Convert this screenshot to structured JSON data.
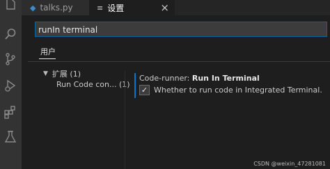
{
  "activity_bar": {
    "items": [
      {
        "icon": "files-icon"
      },
      {
        "icon": "search-icon"
      },
      {
        "icon": "source-control-icon"
      },
      {
        "icon": "run-debug-icon"
      },
      {
        "icon": "extensions-icon"
      },
      {
        "icon": "testing-icon"
      }
    ]
  },
  "tabs": {
    "file_tab": {
      "label": "talks.py",
      "icon": "python-file-icon"
    },
    "settings_tab": {
      "label": "设置",
      "icon": "settings-file-icon",
      "close": "×"
    }
  },
  "search": {
    "value": "runIn terminal"
  },
  "scope": {
    "label": "用户"
  },
  "toc": {
    "group": {
      "label": "扩展 (1)"
    },
    "item": {
      "label": "Run Code con... (1)"
    }
  },
  "setting": {
    "category": "Code-runner: ",
    "name": "Run In Terminal",
    "checked": true,
    "check_glyph": "✓",
    "description": "Whether to run code in Integrated Terminal."
  },
  "watermark": {
    "text": "CSDN @weixin_47281081"
  },
  "colors": {
    "accent": "#007acc",
    "background": "#1e1e1e",
    "activity_bar": "#333333"
  }
}
